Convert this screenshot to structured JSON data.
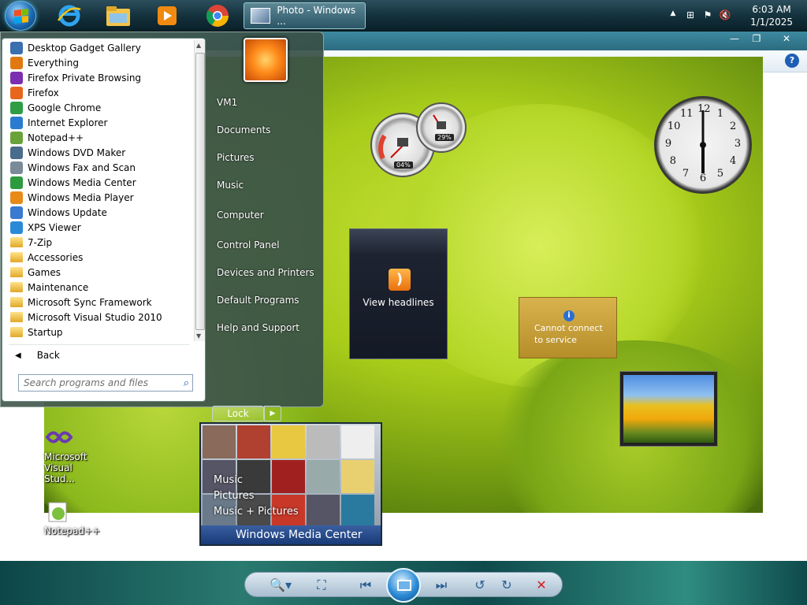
{
  "taskbar": {
    "start_label": "Start",
    "pinned": [
      {
        "name": "Internet Explorer"
      },
      {
        "name": "Windows Explorer"
      },
      {
        "name": "Windows Media Player"
      },
      {
        "name": "Google Chrome"
      }
    ],
    "active_task": "Photo - Windows ...",
    "clock_time": "6:03 AM",
    "clock_date": "1/1/2025"
  },
  "window": {
    "minimize": "—",
    "restore": "❐",
    "close": "✕",
    "help": "?"
  },
  "start_menu": {
    "programs": [
      {
        "label": "Desktop Gadget Gallery",
        "icon": "gadget-icon",
        "color": "#3a6fb0"
      },
      {
        "label": "Everything",
        "icon": "search-icon",
        "color": "#e07a10"
      },
      {
        "label": "Firefox Private Browsing",
        "icon": "firefox-private-icon",
        "color": "#7b2fb0"
      },
      {
        "label": "Firefox",
        "icon": "firefox-icon",
        "color": "#e8651c"
      },
      {
        "label": "Google Chrome",
        "icon": "chrome-icon",
        "color": "#2f9d46"
      },
      {
        "label": "Internet Explorer",
        "icon": "ie-icon",
        "color": "#2b7cd0"
      },
      {
        "label": "Notepad++",
        "icon": "notepad-icon",
        "color": "#6aa23a"
      },
      {
        "label": "Windows DVD Maker",
        "icon": "dvd-icon",
        "color": "#4a6c8c"
      },
      {
        "label": "Windows Fax and Scan",
        "icon": "fax-icon",
        "color": "#7a8a98"
      },
      {
        "label": "Windows Media Center",
        "icon": "media-center-icon",
        "color": "#2e9a3e"
      },
      {
        "label": "Windows Media Player",
        "icon": "media-player-icon",
        "color": "#e88a18"
      },
      {
        "label": "Windows Update",
        "icon": "update-icon",
        "color": "#3a7ad0"
      },
      {
        "label": "XPS Viewer",
        "icon": "xps-icon",
        "color": "#2a8ad8"
      },
      {
        "label": "7-Zip",
        "icon": "folder-icon",
        "color": "folder"
      },
      {
        "label": "Accessories",
        "icon": "folder-icon",
        "color": "folder"
      },
      {
        "label": "Games",
        "icon": "folder-icon",
        "color": "folder"
      },
      {
        "label": "Maintenance",
        "icon": "folder-icon",
        "color": "folder"
      },
      {
        "label": "Microsoft Sync Framework",
        "icon": "folder-icon",
        "color": "folder"
      },
      {
        "label": "Microsoft Visual Studio 2010",
        "icon": "folder-icon",
        "color": "folder"
      },
      {
        "label": "Startup",
        "icon": "folder-icon",
        "color": "folder"
      }
    ],
    "back_label": "Back",
    "search_placeholder": "Search programs and files",
    "right_items": [
      {
        "label": "VM1",
        "sep_after": false
      },
      {
        "label": "Documents",
        "sep_after": false
      },
      {
        "label": "Pictures",
        "sep_after": false
      },
      {
        "label": "Music",
        "sep_after": true
      },
      {
        "label": "Computer",
        "sep_after": true
      },
      {
        "label": "Control Panel",
        "sep_after": false
      },
      {
        "label": "Devices and Printers",
        "sep_after": false
      },
      {
        "label": "Default Programs",
        "sep_after": false
      },
      {
        "label": "Help and Support",
        "sep_after": false
      }
    ],
    "lock_label": "Lock"
  },
  "gadgets": {
    "cpu_percent": "04%",
    "memory_percent": "29%",
    "clock_numbers": [
      "12",
      "1",
      "2",
      "3",
      "4",
      "5",
      "6",
      "7",
      "8",
      "9",
      "10",
      "11"
    ],
    "feed_text": "View headlines",
    "weather_text_1": "Cannot connect",
    "weather_text_2": "to service",
    "media_center": {
      "items": [
        "Music",
        "Pictures",
        "Music + Pictures"
      ],
      "footer": "Windows Media Center"
    }
  },
  "desktop_icons": [
    {
      "line1": "Microsoft",
      "line2": "Visual Stud..."
    },
    {
      "line1": "Notepad++",
      "line2": ""
    }
  ],
  "viewer_toolbar": {
    "zoom": "🔍▾",
    "fit": "⛶",
    "previous": "⏮",
    "next": "⏭",
    "rotate_ccw": "↺",
    "rotate_cw": "↻",
    "delete": "✕"
  }
}
